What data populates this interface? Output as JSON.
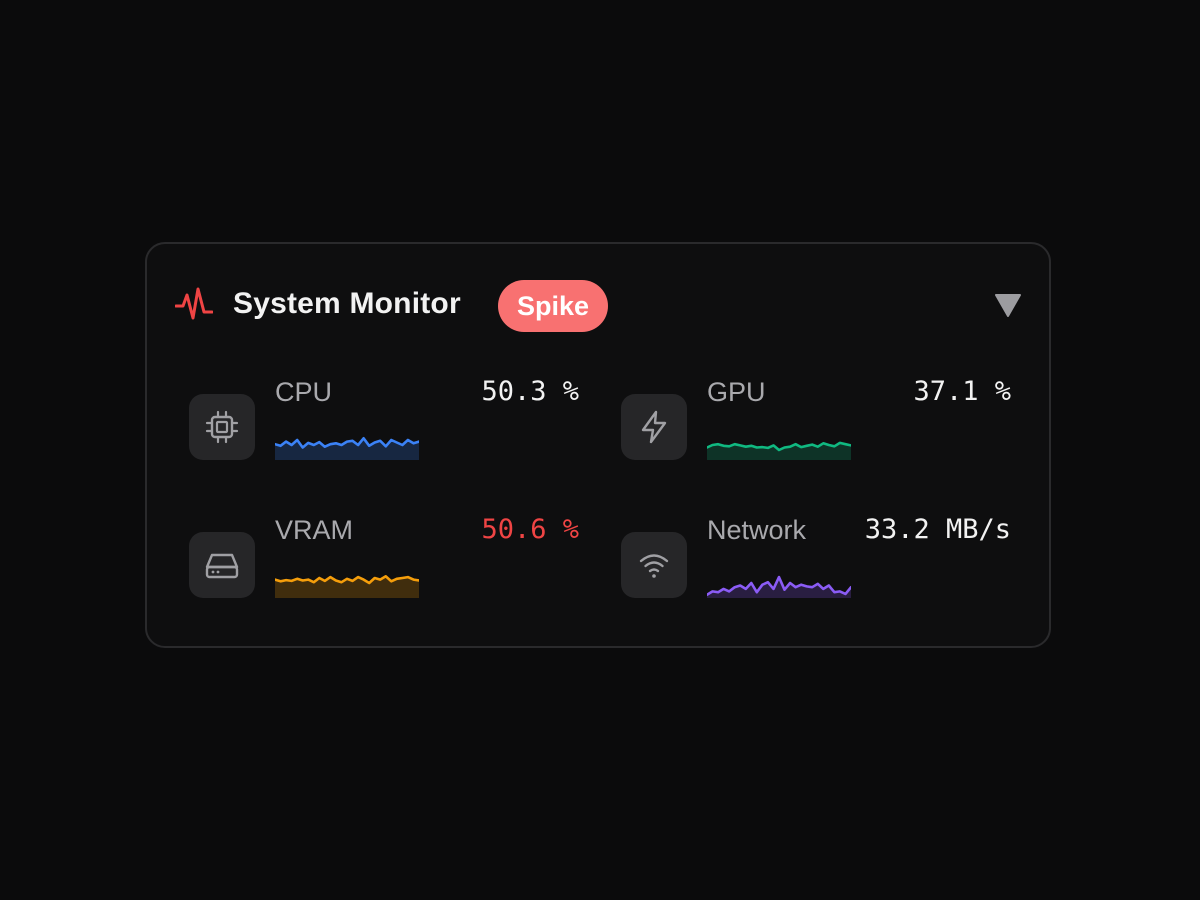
{
  "header": {
    "title": "System Monitor",
    "badge": "Spike",
    "icons": {
      "status": "pulse-icon",
      "collapse": "triangle-down-icon"
    }
  },
  "colors": {
    "background": "#0b0b0c",
    "card": "#0e0e0f",
    "border": "#2a2a2c",
    "accent_red": "#ef4444",
    "badge_bg": "#f87171",
    "value_normal": "#f2f2f2",
    "value_alert": "#ef4444"
  },
  "metrics": [
    {
      "label": "CPU",
      "value": "50.3 %",
      "icon": "cpu-chip-icon",
      "color": "#3b82f6",
      "alert": false,
      "history": [
        52,
        48,
        58,
        50,
        62,
        44,
        55,
        50,
        57,
        46,
        52,
        54,
        50,
        58,
        60,
        50,
        66,
        48,
        56,
        60,
        47,
        62,
        56,
        50,
        62,
        54,
        58
      ]
    },
    {
      "label": "GPU",
      "value": "37.1 %",
      "icon": "lightning-bolt-icon",
      "color": "#10b981",
      "alert": false,
      "history": [
        44,
        50,
        52,
        48,
        47,
        52,
        49,
        46,
        48,
        44,
        45,
        43,
        49,
        38,
        44,
        46,
        52,
        45,
        48,
        51,
        46,
        54,
        50,
        47,
        55,
        52,
        49
      ]
    },
    {
      "label": "VRAM",
      "value": "50.6 %",
      "icon": "hard-drive-icon",
      "color": "#f59e0b",
      "alert": true,
      "history": [
        58,
        54,
        57,
        55,
        60,
        56,
        58,
        52,
        62,
        55,
        64,
        56,
        52,
        60,
        55,
        64,
        58,
        50,
        62,
        58,
        66,
        54,
        60,
        62,
        64,
        58,
        56
      ]
    },
    {
      "label": "Network",
      "value": "33.2 MB/s",
      "icon": "wifi-icon",
      "color": "#8b5cf6",
      "alert": false,
      "history": [
        22,
        30,
        28,
        36,
        30,
        40,
        44,
        36,
        50,
        28,
        46,
        52,
        36,
        64,
        34,
        50,
        40,
        46,
        42,
        40,
        48,
        36,
        44,
        28,
        30,
        24,
        40
      ]
    }
  ]
}
